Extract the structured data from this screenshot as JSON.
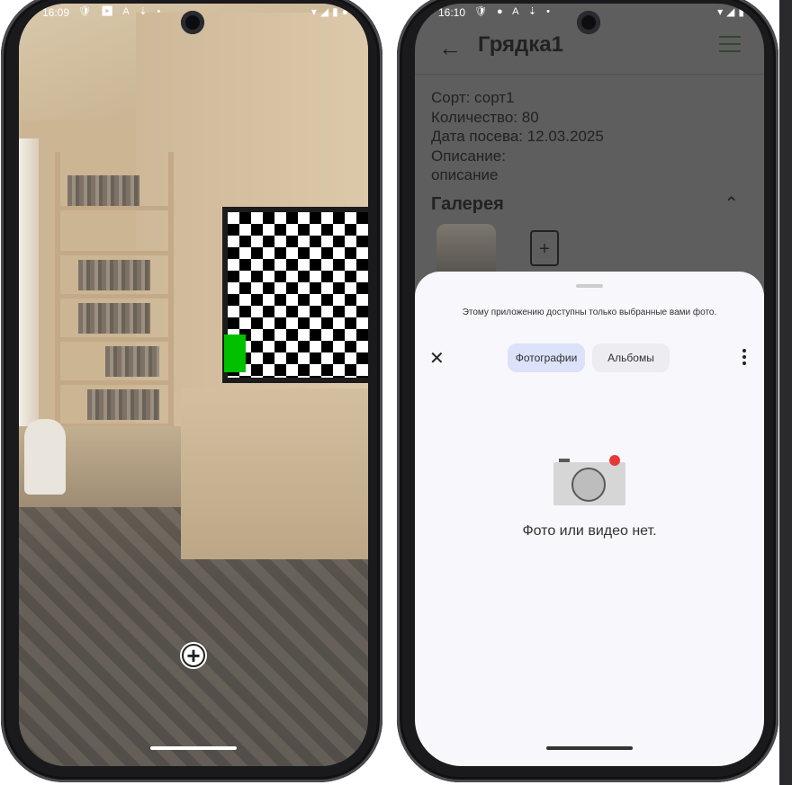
{
  "left_phone": {
    "status": {
      "time": "16:09",
      "icons": "🛡 ▶ A ⇣ •",
      "right_icons": "▾◢▮●"
    },
    "capture_label": "+"
  },
  "right_phone": {
    "status": {
      "time": "16:10",
      "icons": "🛡 ● A ⇣ •",
      "right_icons": "▾◢▮"
    },
    "appbar": {
      "back_icon": "←",
      "title": "Грядка1"
    },
    "details": {
      "sort": "Сорт: сорт1",
      "quantity": "Количество: 80",
      "sow_date": "Дата посева: 12.03.2025",
      "description_label": "Описание:",
      "description": "описание"
    },
    "gallery": {
      "title": "Галерея",
      "collapse_icon": "⌃",
      "add_icon": "+"
    },
    "picker": {
      "notice": "Этому приложению доступны только выбранные вами фото.",
      "close_icon": "✕",
      "tabs": [
        "Фотографии",
        "Альбомы"
      ],
      "empty_message": "Фото или видео нет."
    }
  }
}
